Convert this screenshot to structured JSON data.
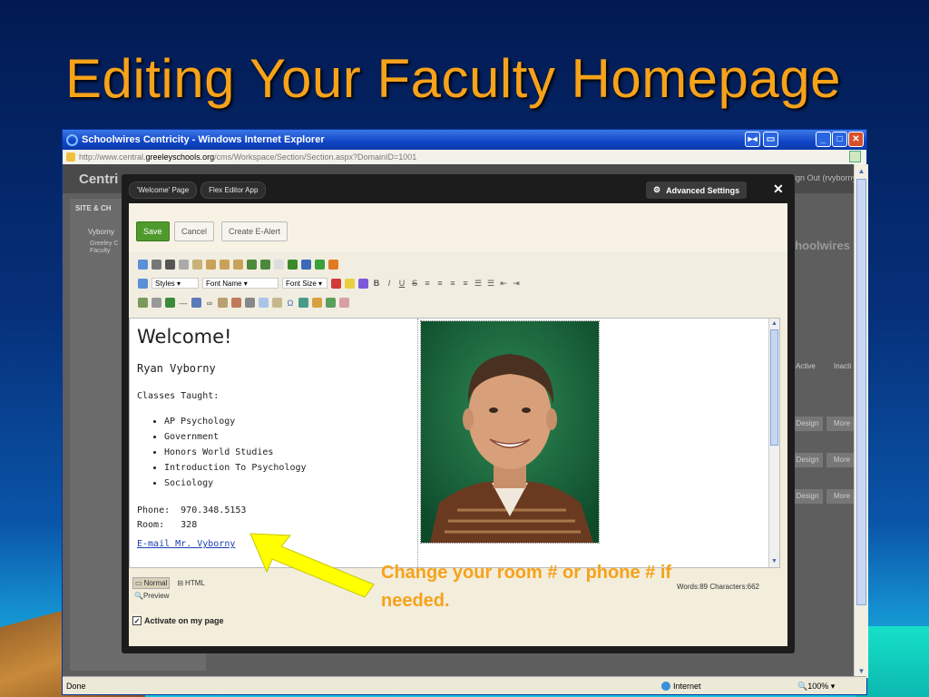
{
  "slide": {
    "title": "Editing Your Faculty Homepage",
    "annotation": "Change your room # or phone # if needed.",
    "colors": {
      "title": "#f6a21a",
      "background": "#06307a",
      "arrow": "#ffff00"
    }
  },
  "browser": {
    "title": "Schoolwires Centricity - Windows Internet Explorer",
    "url_prefix": "http://www.central.",
    "url_host": "greeleyschools.org",
    "url_path": "/cms/Workspace/Section/Section.aspx?DomainID=1001",
    "status": "Done",
    "zone": "Internet",
    "zoom": "100%"
  },
  "cms": {
    "logo": "Centri",
    "signout": "Sign Out (rvyborny)",
    "brand": "choolwires",
    "sidebar_heading": "SITE & CH",
    "sidebar_item": "Vyborny",
    "sidebar_sub": "Greeley C Faculty",
    "col_active": "Active",
    "col_inactive": "Inacti",
    "row_buttons": [
      "Design",
      "More"
    ]
  },
  "modal": {
    "tabs": [
      "'Welcome' Page",
      "Flex Editor App"
    ],
    "advanced_settings": "Advanced Settings",
    "close": "✕",
    "actions": {
      "save": "Save",
      "cancel": "Cancel",
      "create_alert": "Create E-Alert"
    },
    "toolbar": {
      "styles": "Styles",
      "font_name": "Font Name",
      "font_size": "Font Size"
    },
    "editor": {
      "heading": "Welcome!",
      "name": "Ryan Vyborny",
      "classes_label": "Classes Taught:",
      "classes": [
        "AP Psychology",
        "Government",
        "Honors World Studies",
        "Introduction To Psychology",
        "Sociology"
      ],
      "phone_line": "Phone:  970.348.5153",
      "room_line": "Room:   328",
      "email_link": "E-mail Mr. Vyborny"
    },
    "modes": {
      "normal": "Normal",
      "html": "HTML",
      "preview": "Preview"
    },
    "word_count": "Words:89 Characters:662",
    "activate_label": "Activate on my page",
    "activate_checked": true
  }
}
